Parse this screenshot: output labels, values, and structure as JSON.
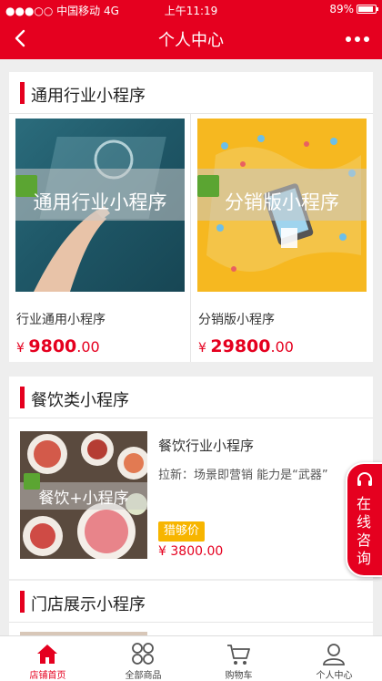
{
  "status_bar": {
    "carrier": "●●●○○ 中国移动",
    "network": "4G",
    "time": "上午11:19",
    "battery": "89%"
  },
  "nav": {
    "title": "个人中心"
  },
  "sections": [
    {
      "title": "通用行业小程序",
      "items": [
        {
          "image_label": "通用行业小程序",
          "name": "行业通用小程序",
          "price_symbol": "¥",
          "price_int": "9800",
          "price_dec": ".00"
        },
        {
          "image_label": "分销版小程序",
          "name": "分销版小程序",
          "price_symbol": "¥",
          "price_int": "29800",
          "price_dec": ".00"
        }
      ]
    },
    {
      "title": "餐饮类小程序",
      "items": [
        {
          "image_label": "餐饮+小程序",
          "name": "餐饮行业小程序",
          "desc": "拉新：场景即营销 能力是“武器”",
          "tag": "猎够价",
          "price_symbol": "¥",
          "price_int": "3800",
          "price_dec": ".00"
        }
      ]
    },
    {
      "title": "门店展示小程序"
    }
  ],
  "consult": {
    "label": "在线咨询"
  },
  "tabbar": [
    {
      "label": "店铺首页",
      "icon": "home-icon",
      "active": true
    },
    {
      "label": "全部商品",
      "icon": "grid-icon",
      "active": false
    },
    {
      "label": "购物车",
      "icon": "cart-icon",
      "active": false
    },
    {
      "label": "个人中心",
      "icon": "user-icon",
      "active": false
    }
  ],
  "colors": {
    "primary": "#e5001f",
    "price": "#e5001f",
    "tag_bg": "#f7b500",
    "badge": "#5ba532",
    "tile2_bg": "#f6b820",
    "tile1_bg": "#1f5868"
  }
}
